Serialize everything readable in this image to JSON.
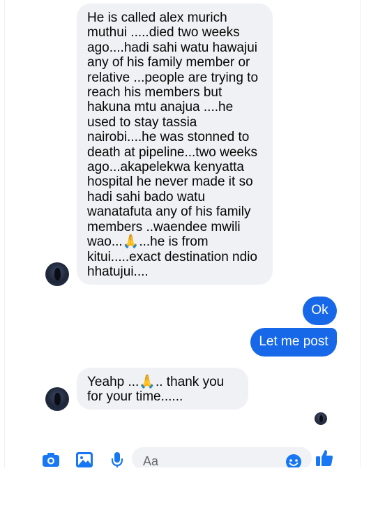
{
  "conversation": {
    "received_message_1": "He is called alex murich muthui .....died two weeks ago....hadi sahi watu hawajui any of his family member or relative ...people are trying to reach his members but hakuna mtu anajua ....he used to stay tassia nairobi....he was stonned to death at pipeline...two weeks ago...akapelekwa kenyatta hospital he never made it so hadi sahi bado watu wanatafuta any of his family members ..waendee mwili wao...🙏...he is from kitui.....exact destination ndio hhatujui....",
    "sent_message_1": "Ok",
    "sent_message_2": "Let me post",
    "received_message_2": "Yeahp ...🙏.. thank you for your time......"
  },
  "composer": {
    "placeholder": "Aa",
    "icons": [
      "camera-icon",
      "gallery-icon",
      "microphone-icon",
      "emoji-icon",
      "thumbs-up-icon"
    ]
  },
  "colors": {
    "sent_bubble": "#1768e8",
    "received_bubble": "#f0f1f4",
    "accent": "#1877f2"
  }
}
